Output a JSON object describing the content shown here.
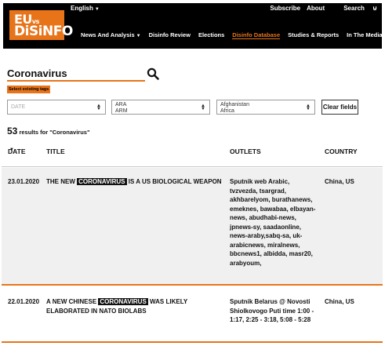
{
  "header": {
    "logo_line1": "EU",
    "logo_line1_small": "vs",
    "logo_line2": "DiSiNFO",
    "language": "English",
    "top_links": [
      "Subscribe",
      "About"
    ],
    "search_label": "Search",
    "nav": [
      {
        "label": "News And Analysis",
        "dropdown": true,
        "active": false
      },
      {
        "label": "Disinfo Review",
        "dropdown": false,
        "active": false
      },
      {
        "label": "Elections",
        "dropdown": false,
        "active": false
      },
      {
        "label": "Disinfo Database",
        "dropdown": false,
        "active": true
      },
      {
        "label": "Studies & Reports",
        "dropdown": false,
        "active": false
      },
      {
        "label": "In The Media",
        "dropdown": false,
        "active": false
      }
    ]
  },
  "colors": {
    "accent": "#e8741a",
    "topbar": "#000000",
    "row_alt": "#f0f0f0"
  },
  "search": {
    "value": "Coronavirus",
    "icon": "magnifier-icon",
    "tags_button": "Select existing tags"
  },
  "filters": {
    "date_placeholder": "DATE",
    "language_values": [
      "ARA",
      "ARM"
    ],
    "country_values": [
      "Afghanistan",
      "Africa"
    ],
    "clear_label": "Clear fields"
  },
  "results": {
    "count": "53",
    "suffix": "results for \"Coronavirus\""
  },
  "table": {
    "headers": {
      "date": "DATE",
      "title": "TITLE",
      "outlets": "OUTLETS",
      "country": "COUNTRY"
    },
    "rows": [
      {
        "date": "23.01.2020",
        "title_before": "THE NEW ",
        "title_highlight": "CORONAVIRUS",
        "title_after": " IS A US BIOLOGICAL WEAPON",
        "outlets": "Sputnik web Arabic, tvzvezda, tsargrad, akhbarelyom, burathanews, emeknes, bawabaa, elbayan-news, abudhabi-news, jpnews-sy, saadaonline, news-araby,sabq-sa, uk-arabicnews, miralnews, bbcnews1, albidda, masr20, arabyoum,",
        "country": "China, US"
      },
      {
        "date": "22.01.2020",
        "title_before": "A NEW CHINESE ",
        "title_highlight": "CORONAVIRUS",
        "title_after": " WAS LIKELY ELABORATED IN NATO BIOLABS",
        "outlets": "Sputnik Belarus @ Novosti Shiolkovogo Puti time 1:00 - 1:17, 2:25 - 3:18, 5:08 - 5:28",
        "country": "China, US"
      }
    ]
  }
}
